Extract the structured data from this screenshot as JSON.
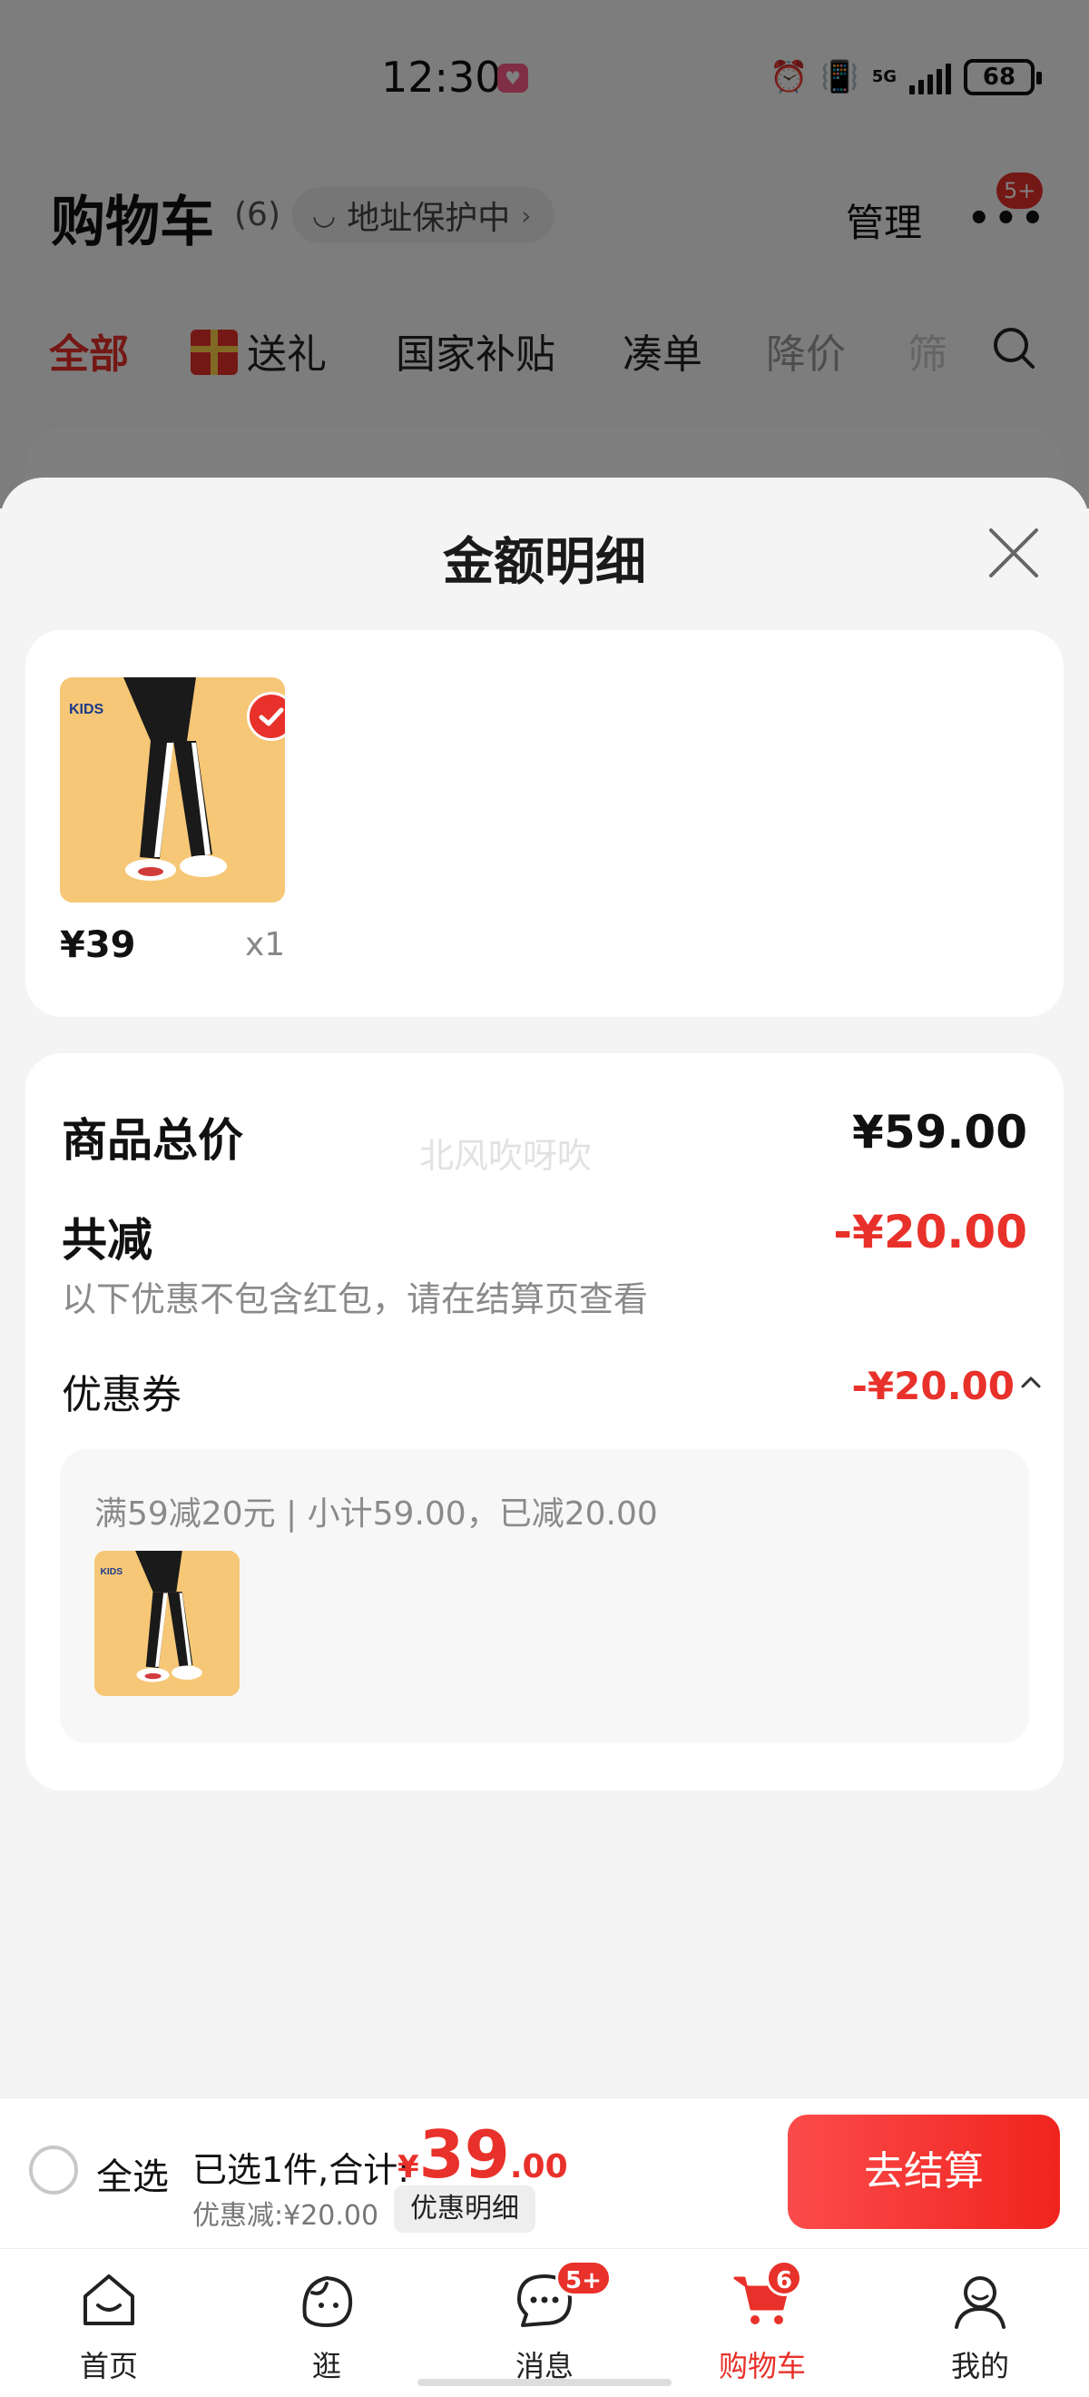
{
  "status_bar": {
    "time": "12:30",
    "network": "5G",
    "battery": "68"
  },
  "header": {
    "title": "购物车",
    "count": "(6)",
    "address_label": "地址保护中",
    "manage_label": "管理",
    "more_badge": "5+"
  },
  "tabs": [
    {
      "label": "全部"
    },
    {
      "label": "送礼"
    },
    {
      "label": "国家补贴"
    },
    {
      "label": "凑单"
    },
    {
      "label": "降价"
    },
    {
      "label": "筛"
    }
  ],
  "sheet": {
    "title": "金额明细",
    "product": {
      "price": "¥39",
      "quantity": "x1"
    },
    "summary": {
      "total_label": "商品总价",
      "total_value": "¥59.00",
      "watermark": "北风吹呀吹",
      "reduce_label": "共减",
      "reduce_value": "-¥20.00",
      "note": "以下优惠不包含红包，请在结算页查看",
      "coupon_label": "优惠券",
      "coupon_value": "-¥20.00",
      "coupon_detail": "满59减20元 | 小计59.00，已减20.00"
    }
  },
  "checkout": {
    "select_all": "全选",
    "selected_text": "已选1件,合计:",
    "currency": "¥",
    "total_int": "39",
    "total_dec": ".00",
    "discount_text": "优惠减:¥20.00",
    "detail_button": "优惠明细",
    "checkout_button": "去结算"
  },
  "bottom_nav": [
    {
      "label": "首页"
    },
    {
      "label": "逛"
    },
    {
      "label": "消息",
      "badge": "5+"
    },
    {
      "label": "购物车",
      "badge": "6"
    },
    {
      "label": "我的"
    }
  ],
  "colors": {
    "accent": "#e8312a",
    "sheet_bg": "#f4f4f4",
    "card_bg": "#ffffff"
  }
}
